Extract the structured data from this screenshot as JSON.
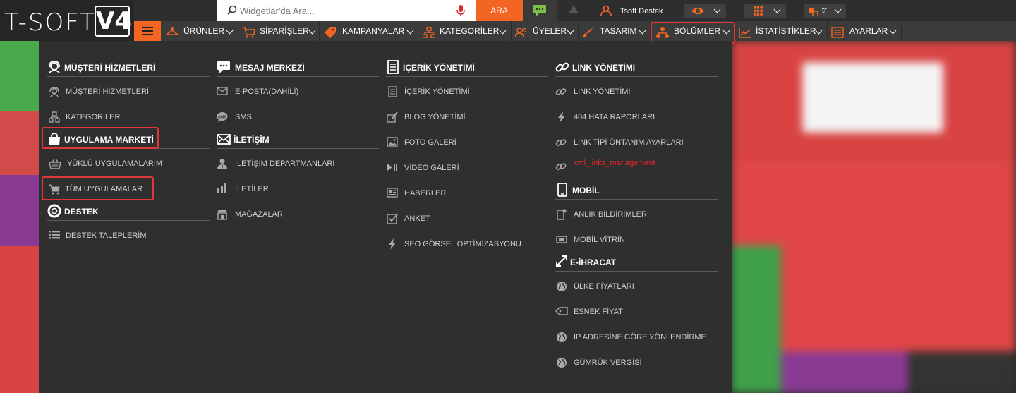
{
  "brand": {
    "logo_text": "T-SOFT",
    "logo_version": "V4"
  },
  "topbar": {
    "search_placeholder": "Widgetlar'da Ara...",
    "search_button": "ARA",
    "user_name": "Tsoft Destek",
    "language": "tr"
  },
  "nav": {
    "items": [
      {
        "label": "ÜRÜNLER"
      },
      {
        "label": "SİPARİŞLER"
      },
      {
        "label": "KAMPANYALAR"
      },
      {
        "label": "KATEGORİLER"
      },
      {
        "label": "ÜYELER"
      },
      {
        "label": "TASARIM"
      },
      {
        "label": "BÖLÜMLER",
        "active": true
      },
      {
        "label": "İSTATİSTİKLER"
      },
      {
        "label": "AYARLAR"
      }
    ]
  },
  "menu": {
    "col1": {
      "musteri_head": "MÜŞTERİ HİZMETLERİ",
      "musteri_items": [
        "MÜŞTERİ HİZMETLERİ",
        "KATEGORİLER"
      ],
      "market_head": "UYGULAMA MARKETİ",
      "market_items": [
        "YÜKLÜ UYGULAMALARIM",
        "TÜM UYGULAMALAR"
      ],
      "destek_head": "DESTEK",
      "destek_items": [
        "DESTEK TALEPLERİM"
      ]
    },
    "col2": {
      "mesaj_head": "MESAJ MERKEZİ",
      "mesaj_items": [
        "E-POSTA(DAHİLİ)",
        "SMS"
      ],
      "iletisim_head": "İLETİŞİM",
      "iletisim_items": [
        "İLETİŞİM DEPARTMANLARI",
        "İLETİLER",
        "MAĞAZALAR"
      ]
    },
    "col3": {
      "icerik_head": "İÇERİK YÖNETİMİ",
      "icerik_items": [
        "İÇERİK YÖNETİMİ",
        "BLOG YÖNETİMİ",
        "FOTO GALERİ",
        "VİDEO GALERİ",
        "HABERLER",
        "ANKET",
        "SEO GÖRSEL OPTİMİZASYONU"
      ]
    },
    "col4": {
      "link_head": "LİNK YÖNETİMİ",
      "link_items": [
        "LİNK YÖNETİMİ",
        "404 HATA RAPORLARI",
        "LİNK TİPİ ÖNTANIM AYARLARI",
        "xml_links_management"
      ],
      "mobil_head": "MOBİL",
      "mobil_items": [
        "ANLIK BİLDİRİMLER",
        "MOBİL VİTRİN"
      ],
      "eihracat_head": "E-İHRACAT",
      "eihracat_items": [
        "ÜLKE FİYATLARI",
        "ESNEK FİYAT",
        "IP ADRESİNE GÖRE YÖNLENDİRME",
        "GÜMRÜK VERGİSİ"
      ]
    }
  },
  "colors": {
    "accent": "#f26522",
    "highlight": "#e0373b",
    "menu_bg": "#2f2f2f",
    "nav_bg": "#3b3b3b"
  }
}
